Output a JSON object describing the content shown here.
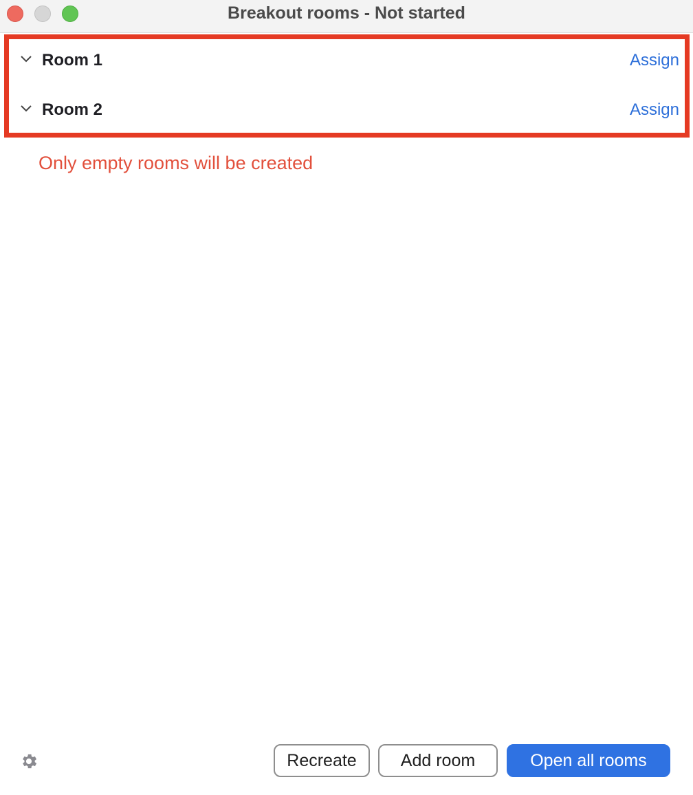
{
  "window": {
    "title": "Breakout rooms - Not started",
    "controls": [
      "close",
      "minimize",
      "zoom"
    ]
  },
  "rooms": [
    {
      "name": "Room 1",
      "action": "Assign",
      "expand_icon": "chevron-down-icon"
    },
    {
      "name": "Room 2",
      "action": "Assign",
      "expand_icon": "chevron-down-icon"
    }
  ],
  "notice": "Only empty rooms will be created",
  "footer": {
    "settings_icon": "gear-icon",
    "recreate_label": "Recreate",
    "add_room_label": "Add room",
    "open_all_label": "Open all rooms"
  },
  "colors": {
    "highlight_border": "#e53a23",
    "link": "#2d6fd9",
    "notice": "#e2503c",
    "primary_button": "#2f72e2"
  }
}
